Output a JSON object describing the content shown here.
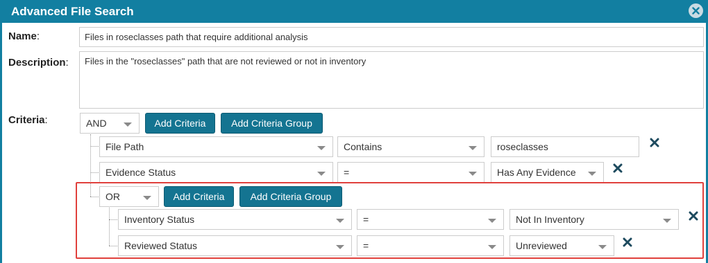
{
  "dialog": {
    "title": "Advanced File Search",
    "close_icon": "close-circle-icon"
  },
  "name": {
    "label": "Name",
    "value": "Files in roseclasses path that require additional analysis"
  },
  "description": {
    "label": "Description",
    "value": "Files in the \"roseclasses\" path that are not reviewed or not in inventory"
  },
  "criteria": {
    "label": "Criteria",
    "operator": "AND",
    "add_criteria_label": "Add Criteria",
    "add_group_label": "Add Criteria Group",
    "rows": [
      {
        "field": "File Path",
        "comparator": "Contains",
        "value": "roseclasses",
        "remove_icon": "close-icon"
      },
      {
        "field": "Evidence Status",
        "comparator": "=",
        "value": "Has Any Evidence",
        "remove_icon": "close-icon"
      }
    ],
    "group": {
      "operator": "OR",
      "add_criteria_label": "Add Criteria",
      "add_group_label": "Add Criteria Group",
      "rows": [
        {
          "field": "Inventory Status",
          "comparator": "=",
          "value": "Not In Inventory",
          "remove_icon": "close-icon"
        },
        {
          "field": "Reviewed Status",
          "comparator": "=",
          "value": "Unreviewed",
          "remove_icon": "close-icon"
        }
      ]
    }
  },
  "colors": {
    "titlebar": "#127fa1",
    "button": "#147491",
    "highlight": "#e0403c",
    "remove_icon": "#1d4a5e"
  }
}
